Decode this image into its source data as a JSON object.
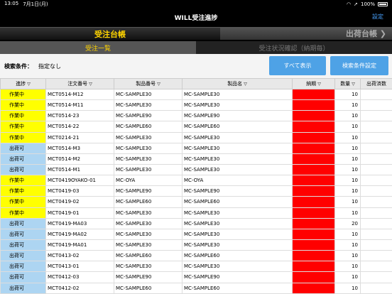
{
  "status_bar": {
    "time": "13:05",
    "date": "7月1日(月)",
    "battery": "100%"
  },
  "nav": {
    "title": "WILL受注進捗",
    "settings": "設定"
  },
  "ledger_tabs": {
    "received": "受注台帳",
    "shipping": "出荷台帳 ❯"
  },
  "sub_tabs": {
    "list": "受注一覧",
    "status": "受注状況確認（納期毎）"
  },
  "filter": {
    "label": "検索条件：",
    "value": "指定なし",
    "show_all": "すべて表示",
    "set_condition": "検索条件設定"
  },
  "filter_icon": "▽",
  "table": {
    "headers": [
      "進捗",
      "注文番号",
      "製品番号",
      "製品名",
      "納期",
      "数量",
      "出荷済数"
    ],
    "rows": [
      {
        "status": "作業中",
        "order": "MCT0514-M12",
        "product_no": "MC-SAMPLE30",
        "product_name": "MC-SAMPLE30",
        "qty": "10"
      },
      {
        "status": "作業中",
        "order": "MCT0514-M11",
        "product_no": "MC-SAMPLE30",
        "product_name": "MC-SAMPLE30",
        "qty": "10"
      },
      {
        "status": "作業中",
        "order": "MCT0514-23",
        "product_no": "MC-SAMPLE90",
        "product_name": "MC-SAMPLE90",
        "qty": "10"
      },
      {
        "status": "作業中",
        "order": "MCT0514-22",
        "product_no": "MC-SAMPLE60",
        "product_name": "MC-SAMPLE60",
        "qty": "10"
      },
      {
        "status": "作業中",
        "order": "MCT0214-21",
        "product_no": "MC-SAMPLE30",
        "product_name": "MC-SAMPLE30",
        "qty": "10"
      },
      {
        "status": "出荷可",
        "order": "MCT0514-M3",
        "product_no": "MC-SAMPLE30",
        "product_name": "MC-SAMPLE30",
        "qty": "10"
      },
      {
        "status": "出荷可",
        "order": "MCT0514-M2",
        "product_no": "MC-SAMPLE30",
        "product_name": "MC-SAMPLE30",
        "qty": "10"
      },
      {
        "status": "出荷可",
        "order": "MCT0514-M1",
        "product_no": "MC-SAMPLE30",
        "product_name": "MC-SAMPLE30",
        "qty": "10"
      },
      {
        "status": "作業中",
        "order": "MCT0419OYAKO-01",
        "product_no": "MC-OYA",
        "product_name": "MC-OYA",
        "qty": "10"
      },
      {
        "status": "作業中",
        "order": "MCT0419-03",
        "product_no": "MC-SAMPLE90",
        "product_name": "MC-SAMPLE90",
        "qty": "10"
      },
      {
        "status": "作業中",
        "order": "MCT0419-02",
        "product_no": "MC-SAMPLE60",
        "product_name": "MC-SAMPLE60",
        "qty": "10"
      },
      {
        "status": "作業中",
        "order": "MCT0419-01",
        "product_no": "MC-SAMPLE30",
        "product_name": "MC-SAMPLE30",
        "qty": "10"
      },
      {
        "status": "出荷可",
        "order": "MCT0419-MA03",
        "product_no": "MC-SAMPLE30",
        "product_name": "MC-SAMPLE30",
        "qty": "20"
      },
      {
        "status": "出荷可",
        "order": "MCT0419-MA02",
        "product_no": "MC-SAMPLE30",
        "product_name": "MC-SAMPLE30",
        "qty": "10"
      },
      {
        "status": "出荷可",
        "order": "MCT0419-MA01",
        "product_no": "MC-SAMPLE30",
        "product_name": "MC-SAMPLE30",
        "qty": "10"
      },
      {
        "status": "出荷可",
        "order": "MCT0413-02",
        "product_no": "MC-SAMPLE60",
        "product_name": "MC-SAMPLE60",
        "qty": "10"
      },
      {
        "status": "出荷可",
        "order": "MCT0413-01",
        "product_no": "MC-SAMPLE30",
        "product_name": "MC-SAMPLE30",
        "qty": "10"
      },
      {
        "status": "出荷可",
        "order": "MCT0412-03",
        "product_no": "MC-SAMPLE90",
        "product_name": "MC-SAMPLE90",
        "qty": "10"
      },
      {
        "status": "出荷可",
        "order": "MCT0412-02",
        "product_no": "MC-SAMPLE60",
        "product_name": "MC-SAMPLE60",
        "qty": "10"
      }
    ]
  },
  "colors": {
    "working": "#ffff00",
    "shippable": "#add5f2",
    "due": "#ff0000",
    "accent": "#4ea2e6",
    "tab_active": "#ffd400"
  }
}
